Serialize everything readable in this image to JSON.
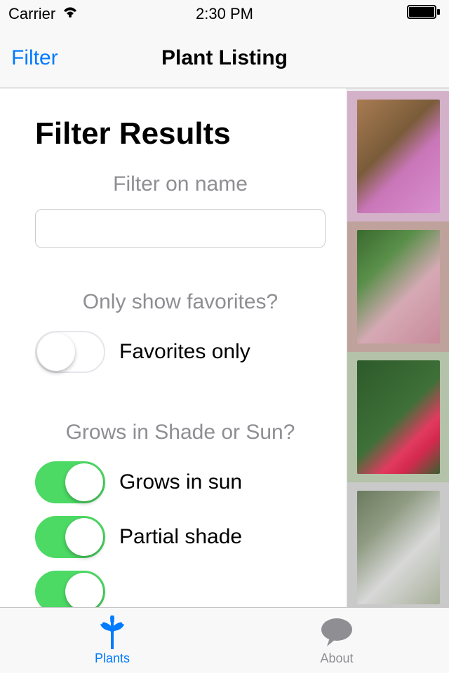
{
  "status": {
    "carrier": "Carrier",
    "time": "2:30 PM"
  },
  "nav": {
    "left_button": "Filter",
    "title": "Plant Listing"
  },
  "filter": {
    "title": "Filter Results",
    "name_label": "Filter on name",
    "name_value": "",
    "favorites_section": "Only show favorites?",
    "favorites_switch_label": "Favorites only",
    "favorites_on": false,
    "sun_section": "Grows in Shade or Sun?",
    "switches": [
      {
        "label": "Grows in sun",
        "on": true
      },
      {
        "label": "Partial shade",
        "on": true
      }
    ]
  },
  "tabs": {
    "plants": "Plants",
    "about": "About"
  }
}
